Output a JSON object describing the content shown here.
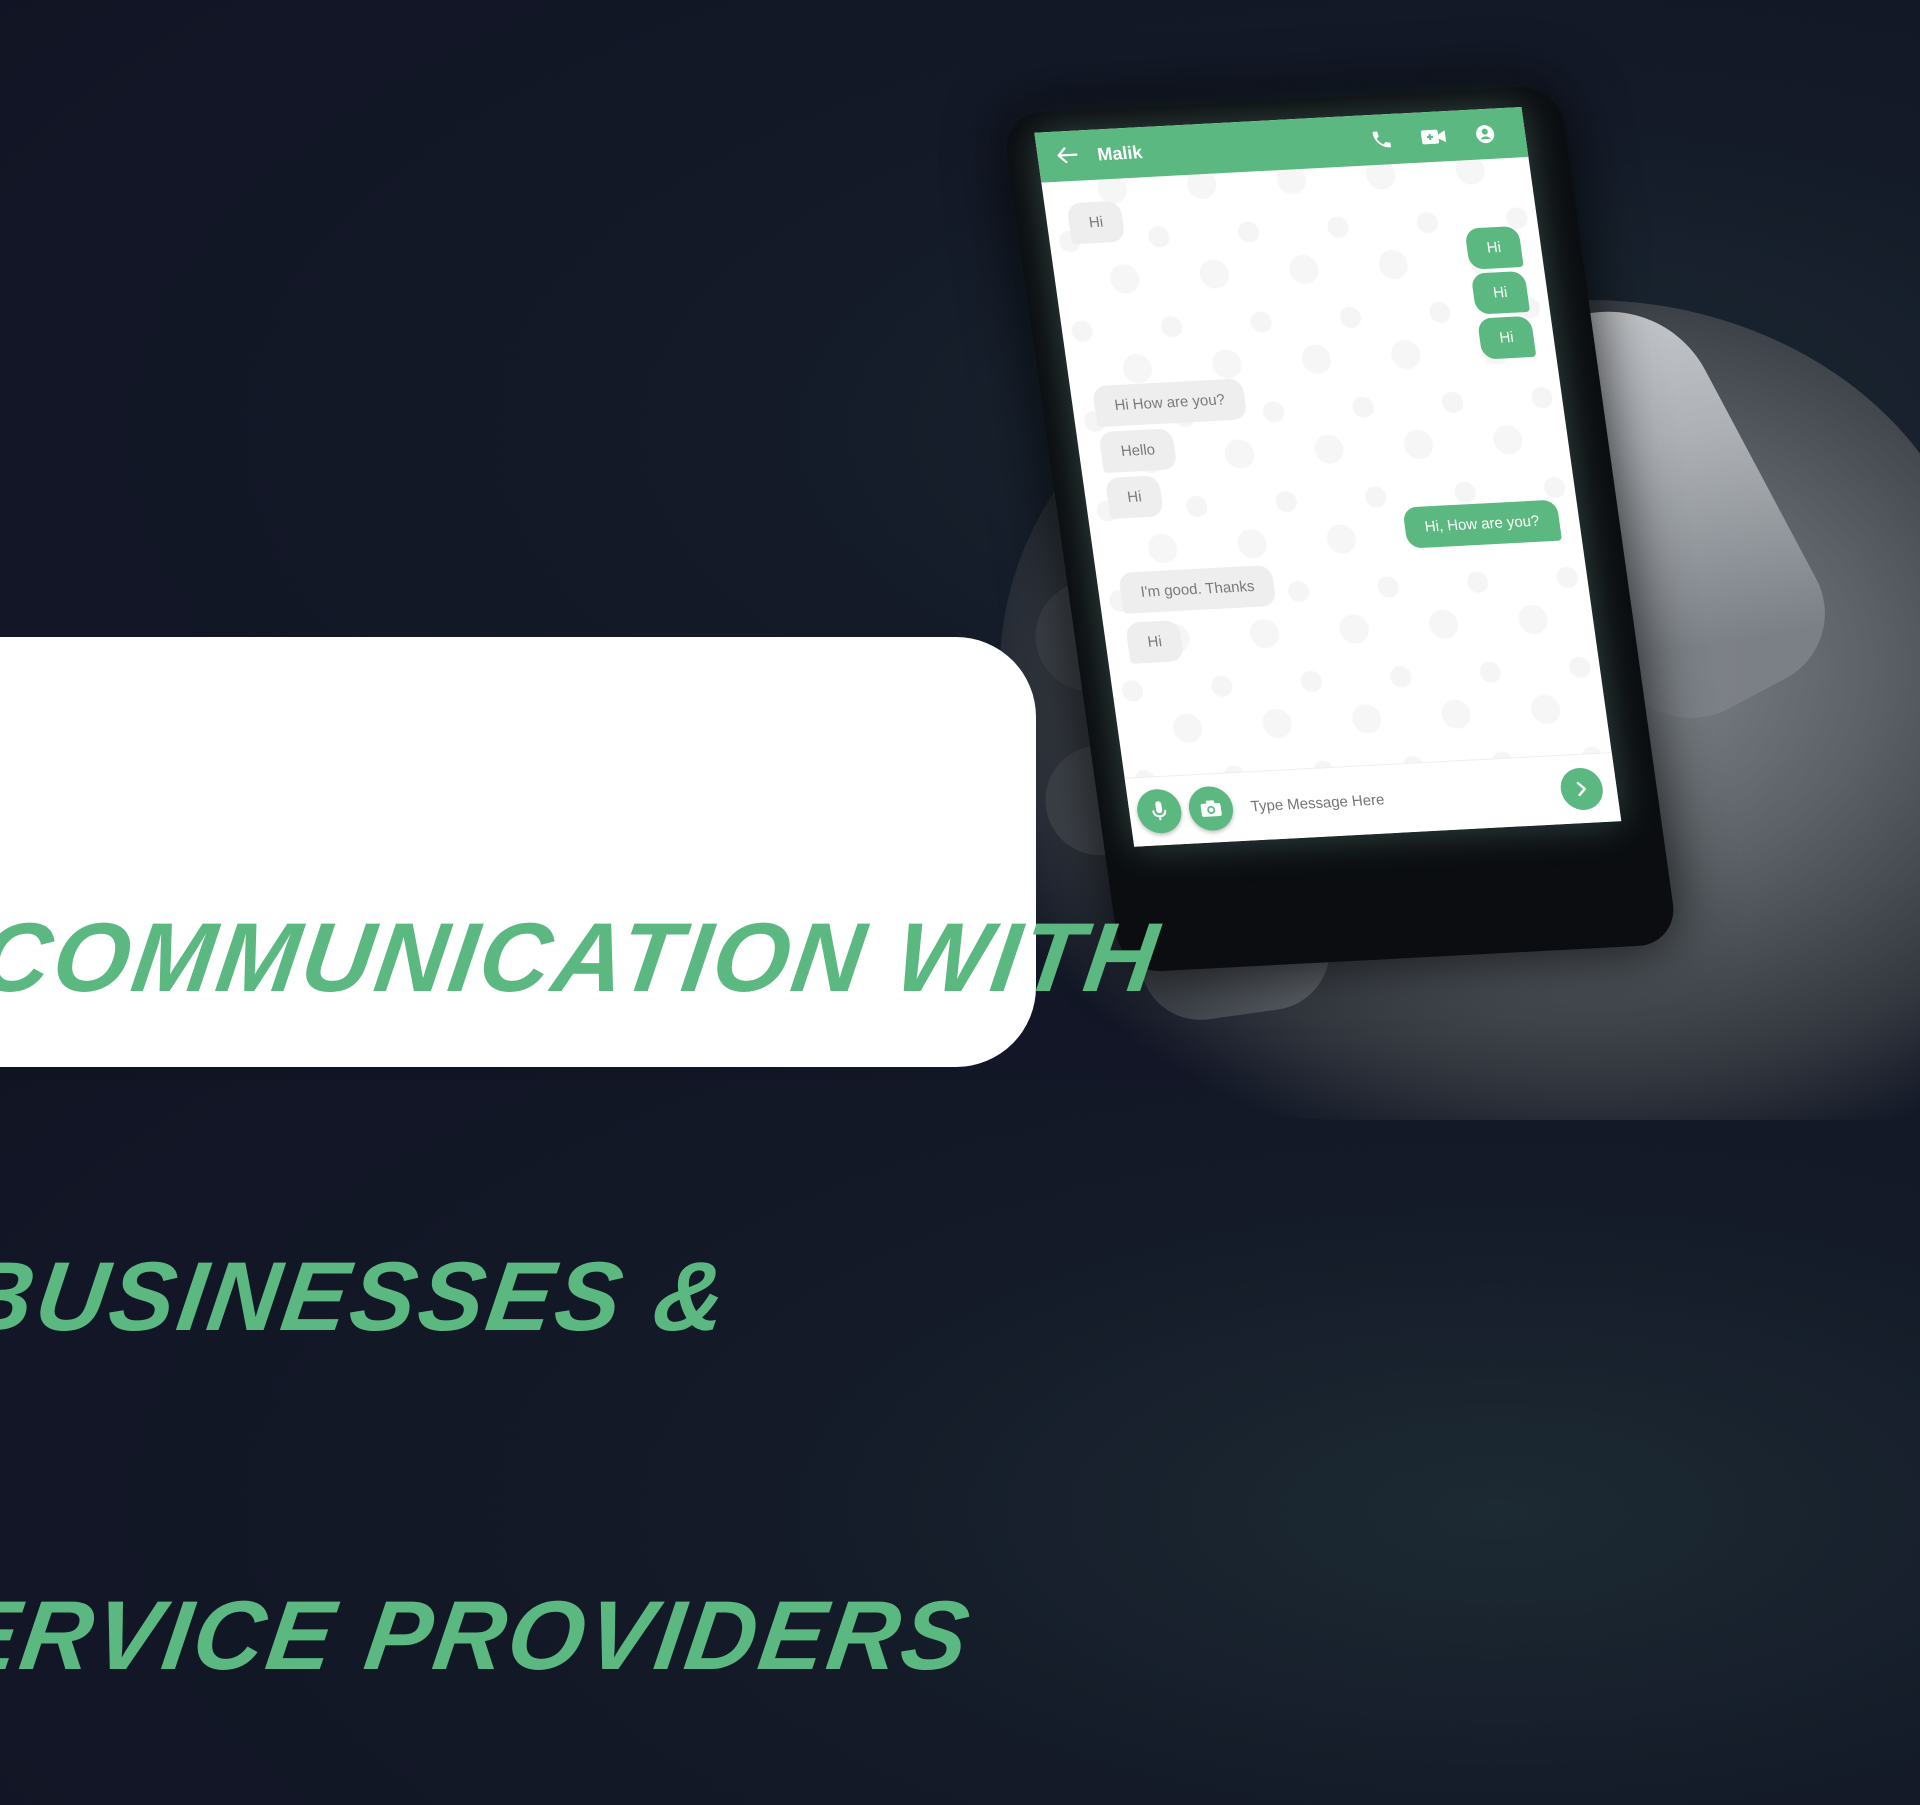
{
  "chat": {
    "contact_name": "Malik",
    "messages": [
      {
        "dir": "in",
        "text": "Hi"
      },
      {
        "dir": "out",
        "text": "Hi"
      },
      {
        "dir": "out",
        "text": "Hi"
      },
      {
        "dir": "out",
        "text": "Hi"
      },
      {
        "dir": "in",
        "text": "Hi How are you?"
      },
      {
        "dir": "in",
        "text": "Hello"
      },
      {
        "dir": "in",
        "text": "Hi"
      },
      {
        "dir": "out",
        "text": "Hi, How are you?"
      },
      {
        "dir": "in",
        "text": "I'm good. Thanks"
      },
      {
        "dir": "in",
        "text": "Hi"
      }
    ],
    "composer_placeholder": "Type Message Here"
  },
  "headline": {
    "line1": "COMMUNICATION WITH",
    "line2": " BUSINESSES &",
    "line3": "SERVICE PROVIDERS"
  },
  "colors": {
    "accent": "#5bb880",
    "background": "#121626",
    "card": "#ffffff"
  },
  "icons": [
    "back-arrow-icon",
    "phone-call-icon",
    "video-call-icon",
    "contact-profile-icon",
    "microphone-icon",
    "camera-icon",
    "send-chevron-icon"
  ]
}
